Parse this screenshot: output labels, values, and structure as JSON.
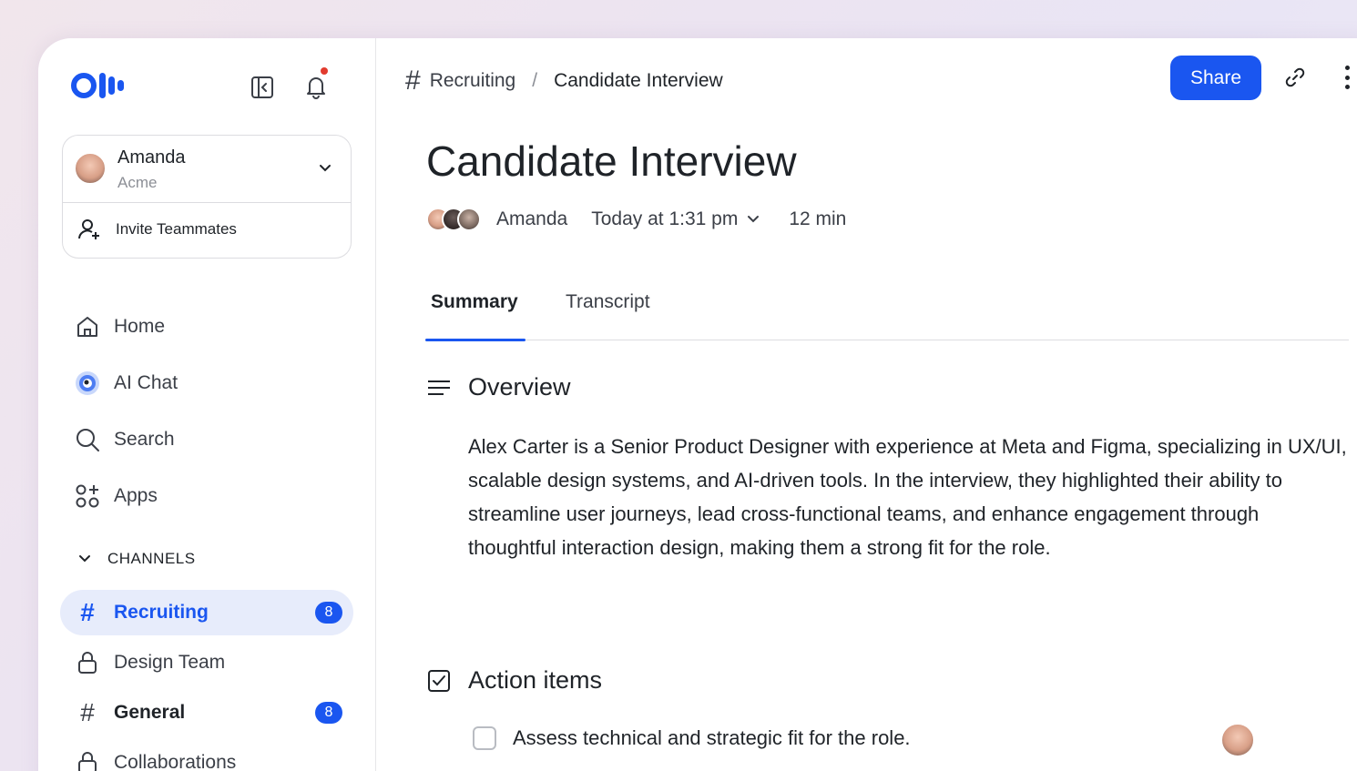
{
  "sidebar": {
    "account": {
      "name": "Amanda",
      "org": "Acme"
    },
    "invite_label": "Invite Teammates",
    "nav": [
      {
        "label": "Home",
        "icon": "home-icon"
      },
      {
        "label": "AI Chat",
        "icon": "ai-chat-icon"
      },
      {
        "label": "Search",
        "icon": "search-icon"
      },
      {
        "label": "Apps",
        "icon": "apps-icon"
      }
    ],
    "channels_heading": "CHANNELS",
    "channels": [
      {
        "label": "Recruiting",
        "icon": "hash-icon",
        "badge": "8",
        "active": true
      },
      {
        "label": "Design Team",
        "icon": "lock-icon"
      },
      {
        "label": "General",
        "icon": "hash-icon",
        "badge": "8"
      },
      {
        "label": "Collaborations",
        "icon": "lock-icon"
      }
    ]
  },
  "header": {
    "breadcrumb": {
      "channel": "Recruiting",
      "separator": "/",
      "current": "Candidate Interview"
    },
    "share_label": "Share"
  },
  "meeting": {
    "title": "Candidate Interview",
    "owner": "Amanda",
    "when": "Today at 1:31 pm",
    "duration": "12 min"
  },
  "tabs": [
    {
      "label": "Summary",
      "active": true
    },
    {
      "label": "Transcript"
    }
  ],
  "overview": {
    "heading": "Overview",
    "text": "Alex Carter is a Senior Product Designer with experience at Meta and Figma, specializing in UX/UI, scalable design systems, and AI-driven tools. In the interview, they highlighted their ability to streamline user journeys, lead cross-functional teams, and enhance engagement through thoughtful interaction design, making them a strong fit for the role."
  },
  "action_items": {
    "heading": "Action items",
    "items": [
      {
        "text": "Assess technical and strategic fit for the role.",
        "done": false
      }
    ]
  },
  "colors": {
    "accent": "#1a56f0",
    "notification": "#e23b2e",
    "active_bg": "#e7ecfb"
  }
}
